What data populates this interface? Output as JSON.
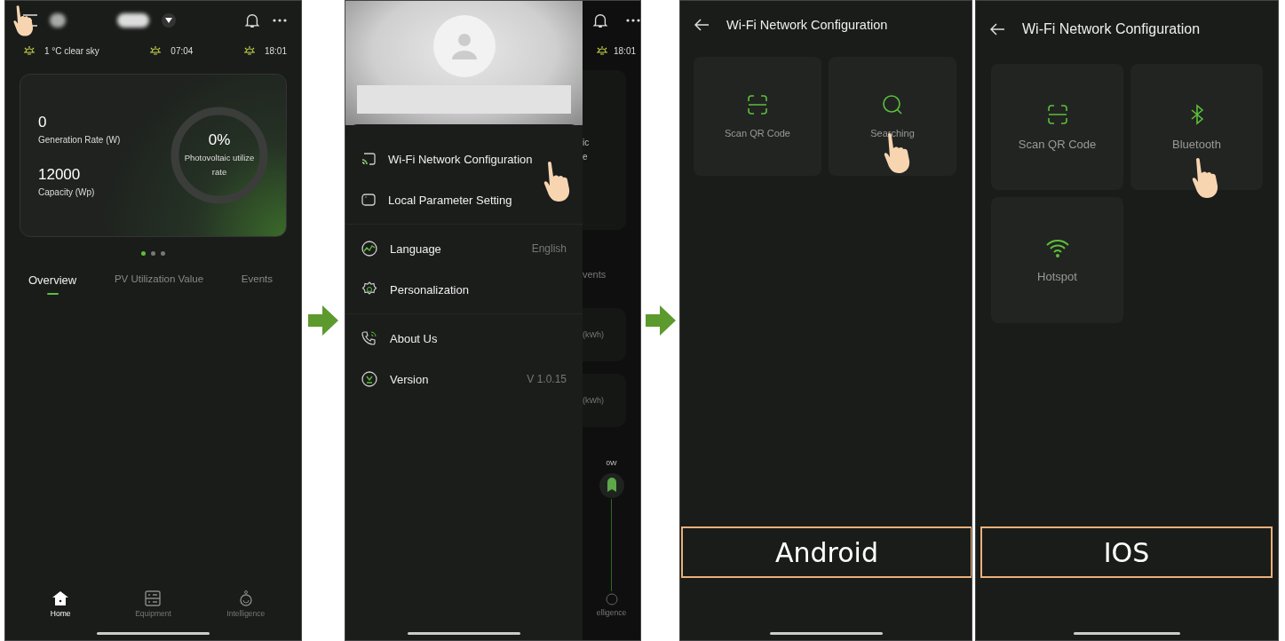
{
  "home_screen": {
    "weather": [
      {
        "text": "1 °C clear sky"
      },
      {
        "text": "07:04"
      },
      {
        "text": "18:01"
      }
    ],
    "stats": [
      {
        "value": "0",
        "label": "Generation Rate (W)"
      },
      {
        "value": "12000",
        "label": "Capacity (Wp)"
      }
    ],
    "gauge": {
      "value": "0%",
      "label": "Photovoltaic utilize rate"
    },
    "pager": [
      {
        "selected": true
      },
      {
        "selected": false
      },
      {
        "selected": false
      }
    ],
    "tabs": [
      {
        "label": "Overview",
        "selected": true
      },
      {
        "label": "PV Utilization Value",
        "selected": false
      },
      {
        "label": "Events",
        "selected": false
      }
    ],
    "nav": [
      {
        "label": "Home",
        "selected": true
      },
      {
        "label": "Equipment",
        "selected": false
      },
      {
        "label": "Intelligence",
        "selected": false
      }
    ]
  },
  "drawer_screen": {
    "menu_groups": [
      [
        {
          "label": "Wi-Fi Network Configuration"
        },
        {
          "label": "Local Parameter Setting"
        }
      ],
      [
        {
          "label": "Language",
          "value": "English"
        },
        {
          "label": "Personalization"
        }
      ],
      [
        {
          "label": "About Us"
        },
        {
          "label": "Version",
          "value": "V 1.0.15"
        }
      ]
    ],
    "behind": {
      "sunset": "18:01",
      "card_text_1": "ic",
      "card_text_2": "e",
      "tab": "vents",
      "energy_1": "(kWh)",
      "energy_2": "(kWh)",
      "power": "0W",
      "nav": "elligence"
    }
  },
  "android_screen": {
    "title": "Wi-Fi Network Configuration",
    "options": [
      {
        "label": "Scan QR Code"
      },
      {
        "label": "Searching"
      }
    ],
    "platform": "Android"
  },
  "ios_screen": {
    "title": "Wi-Fi Network Configuration",
    "options": [
      {
        "label": "Scan QR Code"
      },
      {
        "label": "Bluetooth"
      },
      {
        "label": "Hotspot"
      }
    ],
    "platform": "IOS"
  }
}
